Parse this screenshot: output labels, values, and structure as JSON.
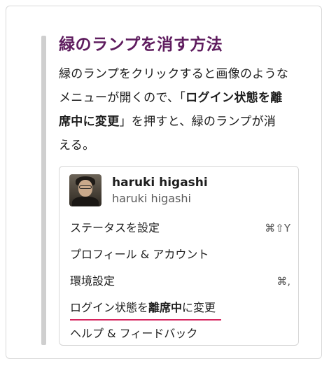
{
  "section": {
    "title": "緑のランプを消す方法",
    "para_line1": "緑のランプをクリックすると画像のような",
    "para_line2_pre": "メニューが開くので、「",
    "para_line2_bold": "ログイン状態を離",
    "para_line3_bold": "席中に変更",
    "para_line3_post": "」を押すと、緑のランプが消",
    "para_line4": "える。"
  },
  "menu": {
    "profile": {
      "name": "haruki higashi",
      "handle": "haruki higashi"
    },
    "items": [
      {
        "label": "ステータスを設定",
        "shortcut": "⌘⇧Y"
      },
      {
        "label": "プロフィール & アカウント",
        "shortcut": ""
      },
      {
        "label": "環境設定",
        "shortcut": "⌘,"
      },
      {
        "label_pre": "ログイン状態を",
        "label_bold": "離席中",
        "label_post": "に変更",
        "shortcut": ""
      },
      {
        "label": "ヘルプ & フィードバック",
        "shortcut": ""
      }
    ],
    "highlight_color": "#d6245e"
  },
  "colors": {
    "title": "#5e1c5e",
    "quote_bar": "#cfcfcf"
  }
}
